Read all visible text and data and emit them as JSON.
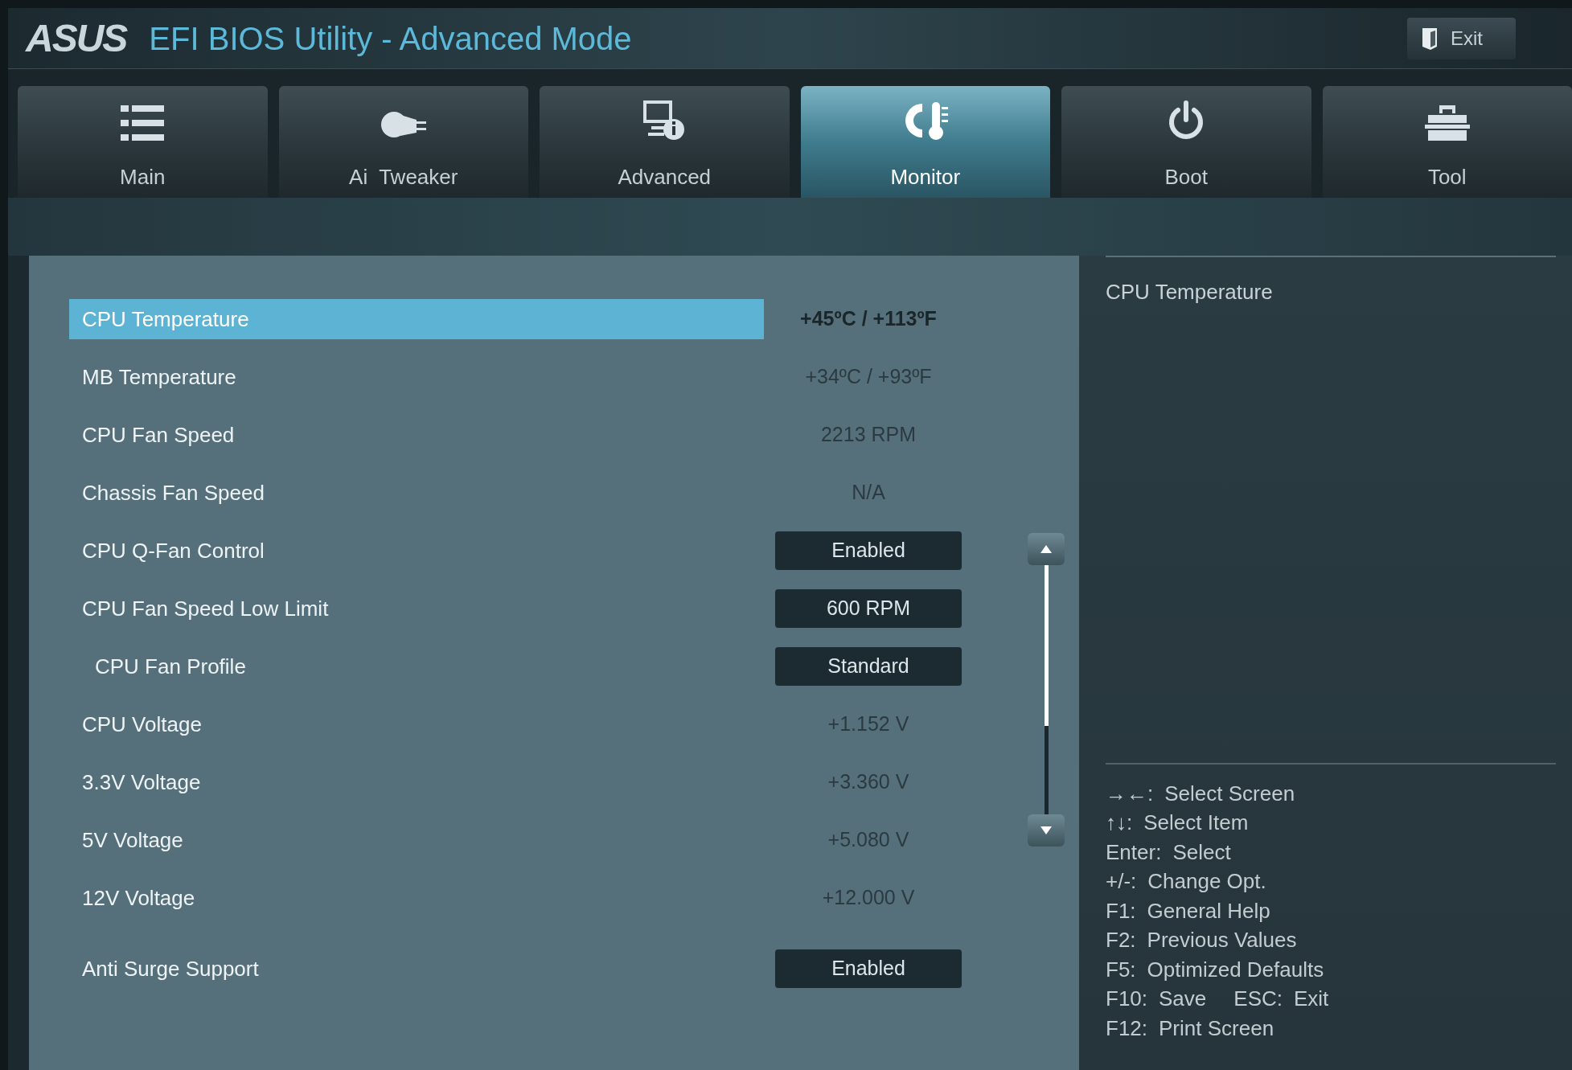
{
  "header": {
    "logo": "ASUS",
    "title": "EFI BIOS Utility - Advanced Mode",
    "exit_button": "Exit"
  },
  "tabs": [
    {
      "label": "Main",
      "selected": false
    },
    {
      "label": "Ai  Tweaker",
      "selected": false
    },
    {
      "label": "Advanced",
      "selected": false
    },
    {
      "label": "Monitor",
      "selected": true
    },
    {
      "label": "Boot",
      "selected": false
    },
    {
      "label": "Tool",
      "selected": false
    }
  ],
  "items": [
    {
      "label": "CPU Temperature",
      "kind": "reading",
      "value": "+45ºC / +113ºF",
      "selected": true
    },
    {
      "label": "MB Temperature",
      "kind": "reading",
      "value": "+34ºC / +93ºF",
      "selected": false
    },
    {
      "label": "CPU Fan Speed",
      "kind": "reading",
      "value": "2213 RPM",
      "selected": false
    },
    {
      "label": "Chassis Fan Speed",
      "kind": "reading",
      "value": "N/A",
      "selected": false
    },
    {
      "label": "CPU Q-Fan Control",
      "kind": "option",
      "value": "Enabled",
      "selected": false
    },
    {
      "label": "CPU Fan Speed Low Limit",
      "kind": "option",
      "value": "600 RPM",
      "selected": false,
      "children": [
        {
          "label": "CPU Fan Profile",
          "kind": "option",
          "value": "Standard",
          "selected": false
        }
      ]
    },
    {
      "label": "CPU Voltage",
      "kind": "reading",
      "value": "+1.152 V",
      "selected": false
    },
    {
      "label": "3.3V Voltage",
      "kind": "reading",
      "value": "+3.360 V",
      "selected": false
    },
    {
      "label": "5V Voltage",
      "kind": "reading",
      "value": "+5.080 V",
      "selected": false
    },
    {
      "label": "12V Voltage",
      "kind": "reading",
      "value": "+12.000 V",
      "selected": false
    }
  ],
  "items_2": [
    {
      "label": "Anti Surge Support",
      "kind": "option",
      "value": "Enabled",
      "selected": false
    }
  ],
  "help": {
    "description": "CPU Temperature",
    "keys": [
      [
        {
          "key": "→←:",
          "action": "Select Screen"
        }
      ],
      [
        {
          "key": "↑↓:",
          "action": "Select Item"
        }
      ],
      [
        {
          "key": "Enter:",
          "action": "Select"
        }
      ],
      [
        {
          "key": "+/-:",
          "action": "Change Opt."
        }
      ],
      [
        {
          "key": "F1:",
          "action": "General Help"
        }
      ],
      [
        {
          "key": "F2:",
          "action": "Previous Values"
        }
      ],
      [
        {
          "key": "F5:",
          "action": "Optimized Defaults"
        }
      ],
      [
        {
          "key": "F10:",
          "action": "Save"
        },
        {
          "key": "ESC:",
          "action": "Exit"
        }
      ],
      [
        {
          "key": "F12:",
          "action": "Print Screen"
        }
      ]
    ]
  }
}
